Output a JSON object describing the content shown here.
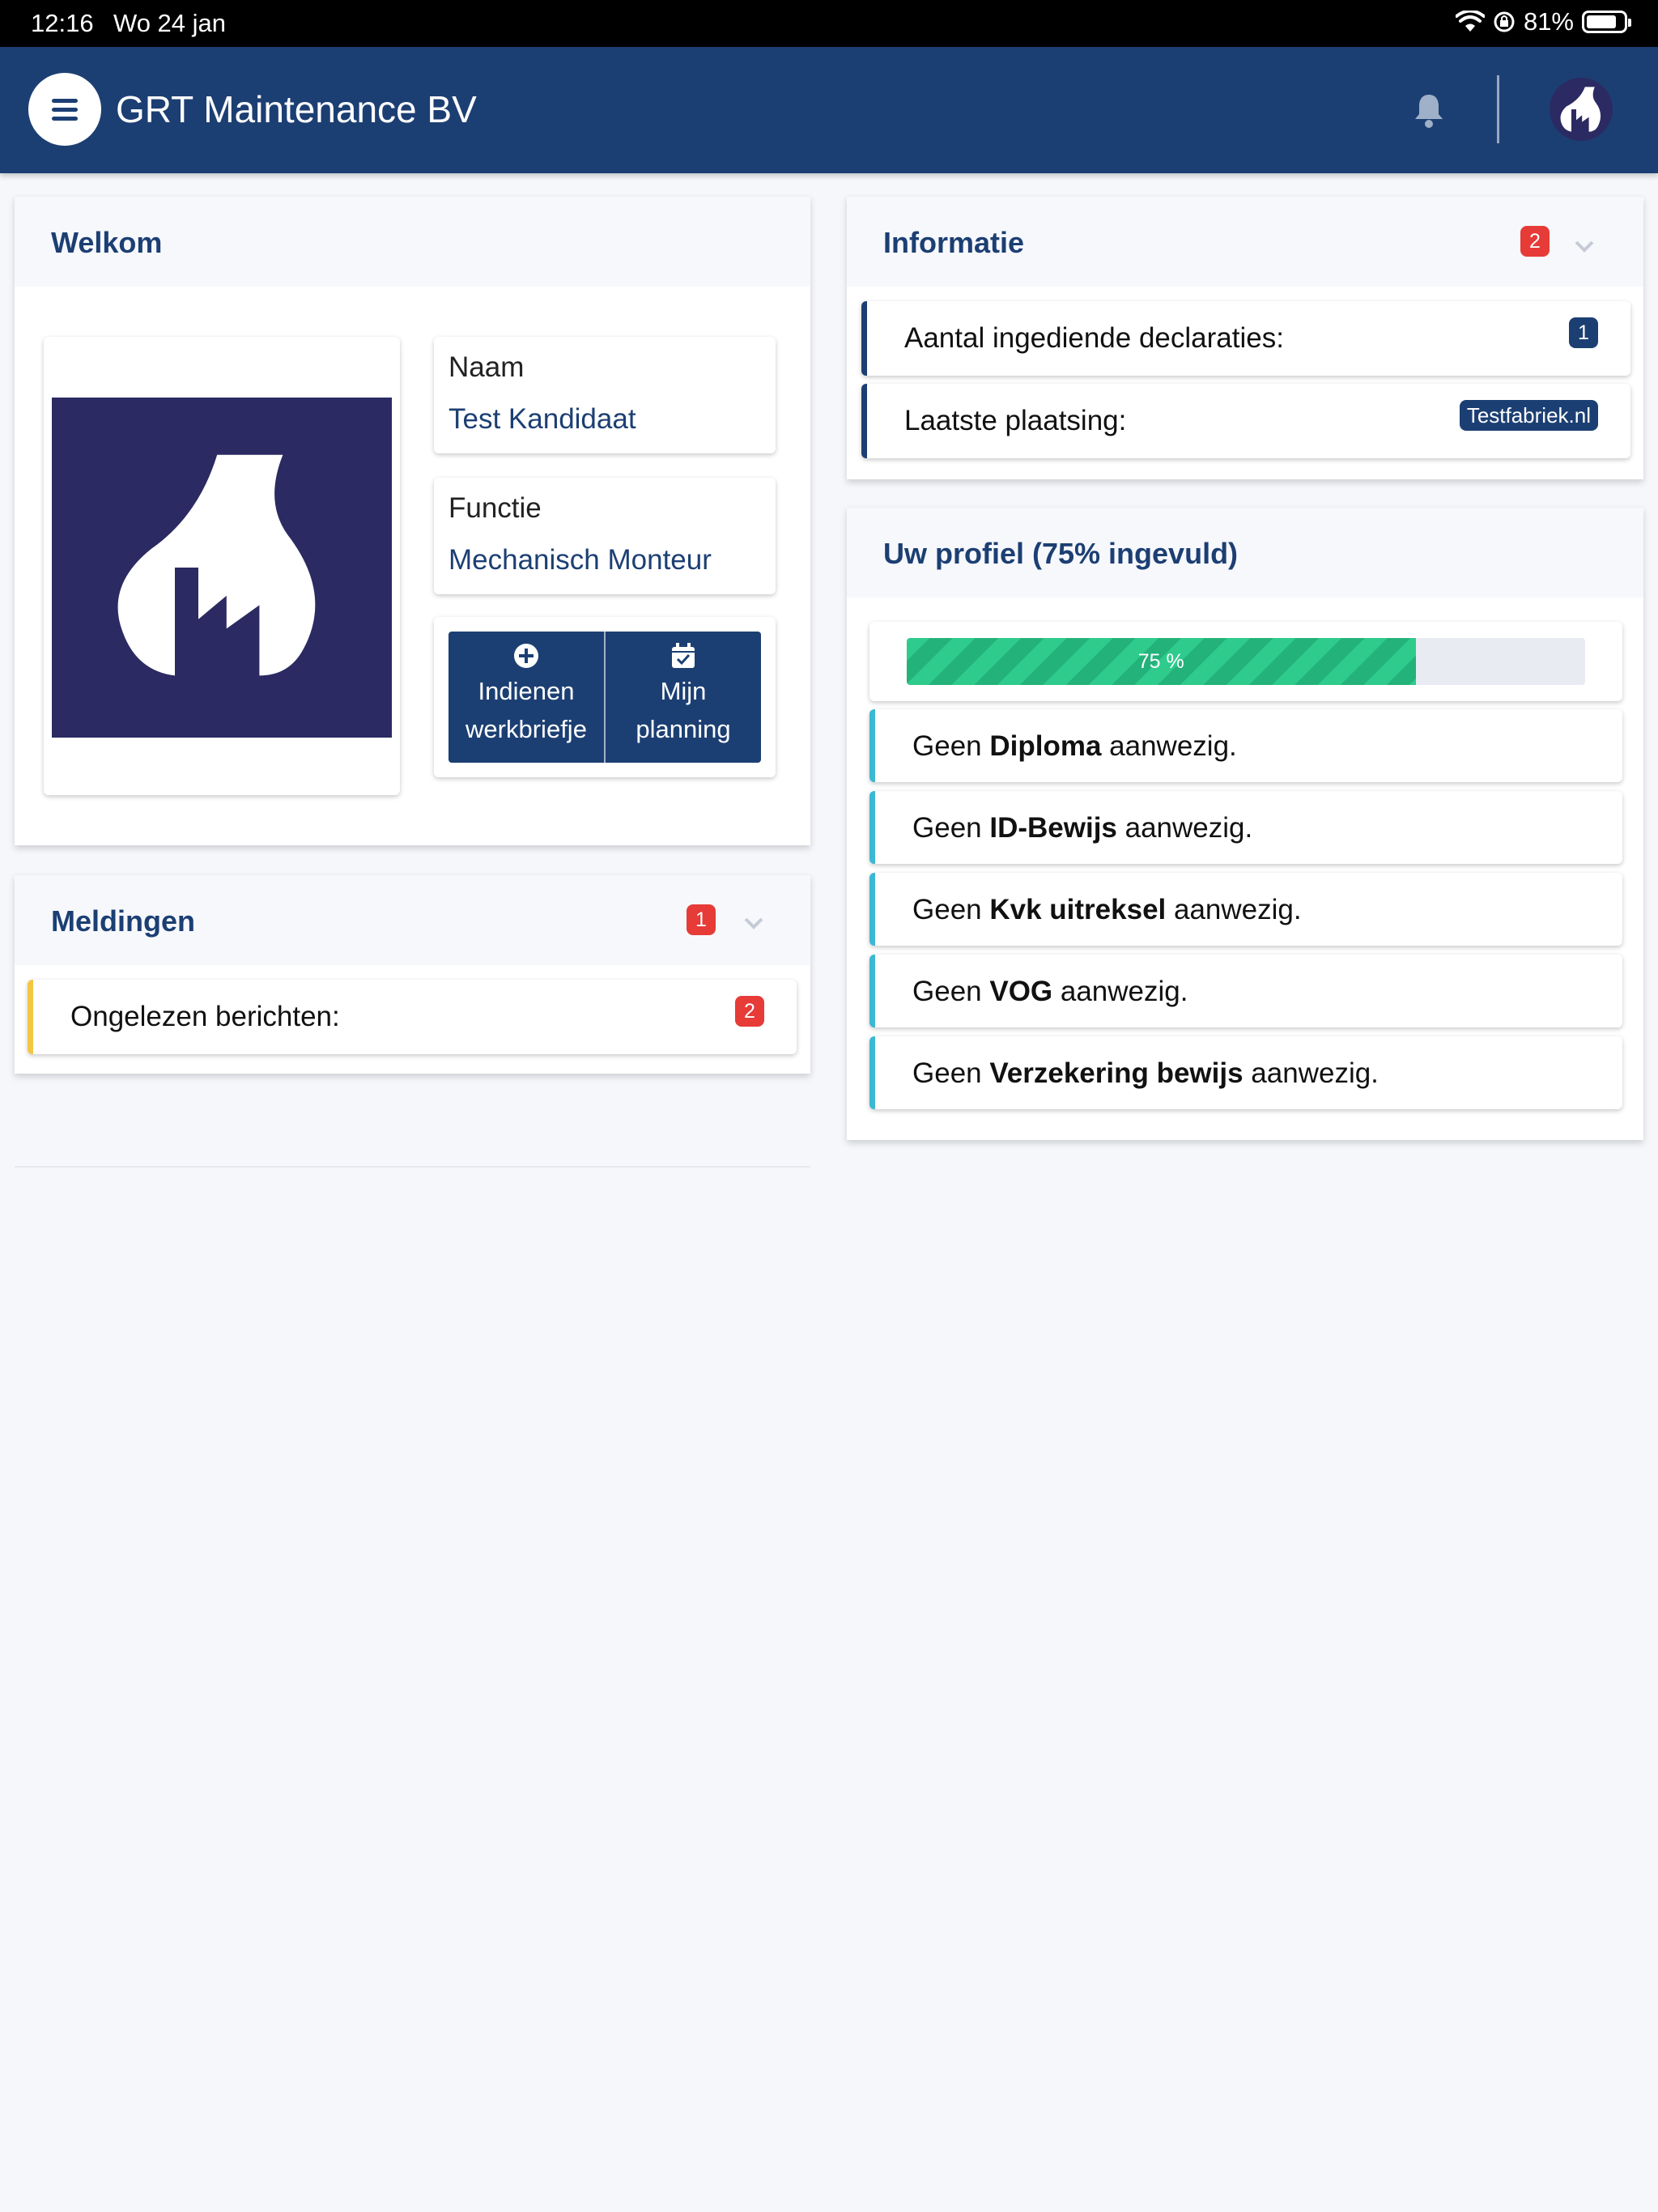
{
  "status_bar": {
    "time": "12:16",
    "date": "Wo 24 jan",
    "battery": "81%"
  },
  "header": {
    "title": "GRT Maintenance BV"
  },
  "welkom": {
    "title": "Welkom",
    "naam_label": "Naam",
    "naam_value": "Test Kandidaat",
    "functie_label": "Functie",
    "functie_value": "Mechanisch Monteur",
    "actions": [
      {
        "icon": "plus-circle-icon",
        "line1": "Indienen",
        "line2": "werkbriefje"
      },
      {
        "icon": "calendar-check-icon",
        "line1": "Mijn",
        "line2": "planning"
      }
    ]
  },
  "meldingen": {
    "title": "Meldingen",
    "badge": "1",
    "items": [
      {
        "label": "Ongelezen berichten:",
        "badge": "2"
      }
    ]
  },
  "informatie": {
    "title": "Informatie",
    "badge": "2",
    "items": [
      {
        "label": "Aantal ingediende declaraties:",
        "badge": "1"
      },
      {
        "label": "Laatste plaatsing:",
        "badge": "Testfabriek.nl"
      }
    ]
  },
  "profiel": {
    "title": "Uw profiel (75% ingevuld)",
    "progress_percent": 75,
    "progress_label": "75 %",
    "items": [
      {
        "prefix": "Geen ",
        "bold": "Diploma",
        "suffix": " aanwezig."
      },
      {
        "prefix": "Geen ",
        "bold": "ID-Bewijs",
        "suffix": " aanwezig."
      },
      {
        "prefix": "Geen ",
        "bold": "Kvk uitreksel",
        "suffix": " aanwezig."
      },
      {
        "prefix": "Geen ",
        "bold": "VOG",
        "suffix": " aanwezig."
      },
      {
        "prefix": "Geen ",
        "bold": "Verzekering bewijs",
        "suffix": " aanwezig."
      }
    ]
  },
  "colors": {
    "brand": "#1c3f73",
    "badge_red": "#e63b37",
    "warning_accent": "#f3c744",
    "info_accent": "#3bb8d3",
    "progress_green": "#2ecb8c"
  }
}
